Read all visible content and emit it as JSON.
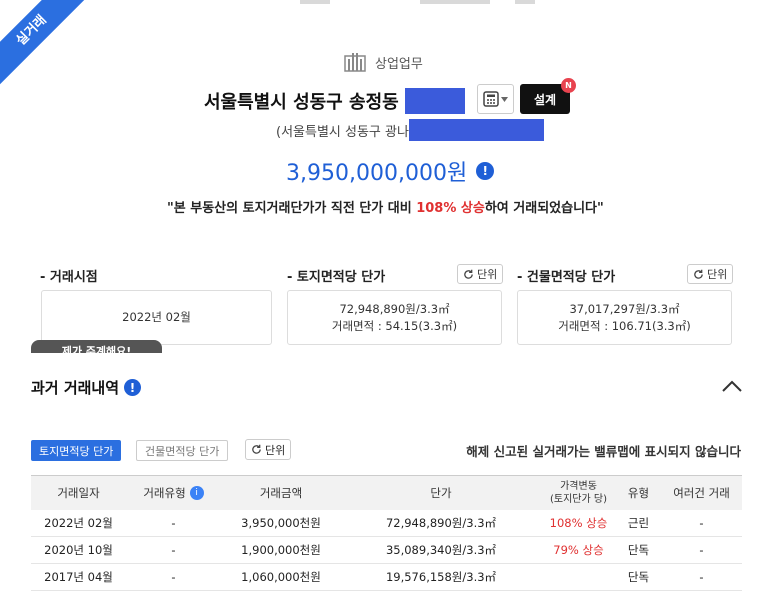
{
  "ribbon": "실거래",
  "property": {
    "category": "상업업무",
    "address_main": "서울특별시 성동구 송정동",
    "address_sub": "(서울특별시 성동구 광나",
    "design_label": "설계",
    "new_badge": "N",
    "price": "3,950,000,000원",
    "notice_pre": "\"본 부동산의 토지거래단가가 직전 단가 대비 ",
    "notice_highlight": "108% 상승",
    "notice_post": "하여 거래되었습니다\""
  },
  "summary": {
    "deal_date": {
      "label": "- 거래시점",
      "value": "2022년 02월"
    },
    "land_unit": {
      "label": "- 토지면적당 단가",
      "unit_button": "단위",
      "price": "72,948,890원/3.3㎡",
      "area": "거래면적 : 54.15(3.3㎡)"
    },
    "building_unit": {
      "label": "- 건물면적당 단가",
      "unit_button": "단위",
      "price": "37,017,297원/3.3㎡",
      "area": "거래면적 : 106.71(3.3㎡)"
    },
    "tooltip_peek": "제가 주계해요!"
  },
  "history": {
    "title": "과거 거래내역",
    "tab_land": "토지면적당 단가",
    "tab_building": "건물면적당 단가",
    "unit_button": "단위",
    "note": "해제 신고된 실거래가는 밸류맵에 표시되지 않습니다",
    "columns": [
      "거래일자",
      "거래유형",
      "거래금액",
      "단가",
      "가격변동\n(토지단가 당)",
      "유형",
      "여러건 거래"
    ],
    "rows": [
      {
        "date": "2022년 02월",
        "type": "-",
        "amount": "3,950,000천원",
        "unit": "72,948,890원/3.3㎡",
        "change": "108% 상승",
        "kind": "근린",
        "multi": "-"
      },
      {
        "date": "2020년 10월",
        "type": "-",
        "amount": "1,900,000천원",
        "unit": "35,089,340원/3.3㎡",
        "change": "79% 상승",
        "kind": "단독",
        "multi": "-"
      },
      {
        "date": "2017년 04월",
        "type": "-",
        "amount": "1,060,000천원",
        "unit": "19,576,158원/3.3㎡",
        "change": "",
        "kind": "단독",
        "multi": "-"
      }
    ]
  },
  "colors": {
    "accent": "#2b6fe0",
    "price": "#1f5fd6",
    "up": "#e03131",
    "redact": "#3b5bdb"
  }
}
